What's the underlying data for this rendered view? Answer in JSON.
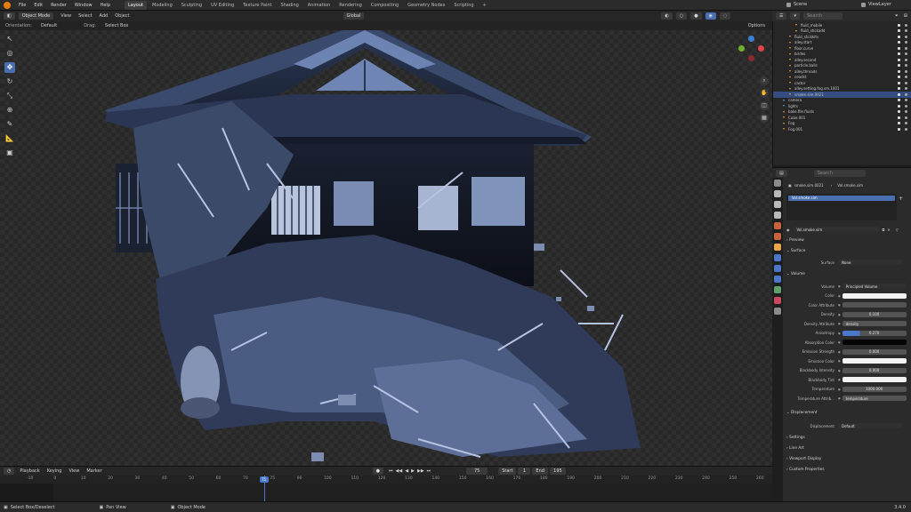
{
  "menu": {
    "items": [
      "File",
      "Edit",
      "Render",
      "Window",
      "Help"
    ]
  },
  "workspaces": [
    "Layout",
    "Modeling",
    "Sculpting",
    "UV Editing",
    "Texture Paint",
    "Shading",
    "Animation",
    "Rendering",
    "Compositing",
    "Geometry Nodes",
    "Scripting"
  ],
  "active_workspace": "Layout",
  "scene": {
    "scene_name": "Scene",
    "view_layer": "ViewLayer"
  },
  "viewport_header": {
    "mode": "Object Mode",
    "menus": [
      "View",
      "Select",
      "Add",
      "Object"
    ],
    "transform": "Global",
    "orientation_label": "Orientation:",
    "orientation_value": "Default",
    "drag_label": "Drag:",
    "drag_value": "Select Box",
    "options": "Options"
  },
  "outliner": {
    "search_placeholder": "Search",
    "rows": [
      {
        "name": "fluid_mobile",
        "indent": 3,
        "color": "#e8a54b",
        "selected": false
      },
      {
        "name": "fluid_stickadd",
        "indent": 3,
        "color": "#e8a54b",
        "selected": false
      },
      {
        "name": "fluid_stickkits",
        "indent": 2,
        "color": "#e8a54b",
        "selected": false
      },
      {
        "name": "alley.start",
        "indent": 2,
        "color": "#e8a54b",
        "selected": false
      },
      {
        "name": "floor.curve",
        "indent": 2,
        "color": "#e8a54b",
        "selected": false
      },
      {
        "name": "brides",
        "indent": 2,
        "color": "#e8a54b",
        "selected": false
      },
      {
        "name": "alley.second",
        "indent": 2,
        "color": "#e8a54b",
        "selected": false
      },
      {
        "name": "particle.balls",
        "indent": 2,
        "color": "#e8a54b",
        "selected": false
      },
      {
        "name": "alley.threads",
        "indent": 2,
        "color": "#e8a54b",
        "selected": false
      },
      {
        "name": "ceadst",
        "indent": 2,
        "color": "#e8a54b",
        "selected": false
      },
      {
        "name": "castor",
        "indent": 2,
        "color": "#e8a54b",
        "selected": false
      },
      {
        "name": "alley.setting.fog.sm.1001",
        "indent": 2,
        "color": "#e8a54b",
        "selected": false
      },
      {
        "name": "smoke.sim.0021",
        "indent": 2,
        "color": "#e8a54b",
        "selected": true
      },
      {
        "name": "camera",
        "indent": 1,
        "color": "#6ca0dc",
        "selected": false
      },
      {
        "name": "lights",
        "indent": 1,
        "color": "#6ca0dc",
        "selected": false
      },
      {
        "name": "bake.file.fluids",
        "indent": 1,
        "color": "#e8a54b",
        "selected": false
      },
      {
        "name": "Cube.001",
        "indent": 1,
        "color": "#e8a54b",
        "selected": false
      },
      {
        "name": "Fog",
        "indent": 1,
        "color": "#e8a54b",
        "selected": false
      },
      {
        "name": "Fog.001",
        "indent": 1,
        "color": "#e8a54b",
        "selected": false
      }
    ]
  },
  "properties": {
    "search_placeholder": "Search",
    "breadcrumb_object": "smoke.sim.0021",
    "breadcrumb_material": "Vol.smoke.sim",
    "material_slot": "Vol.smoke.sim",
    "material_name": "Vol.smoke.sim",
    "sections": {
      "preview": "Preview",
      "surface": "Surface",
      "volume": "Volume",
      "displacement": "Displacement",
      "settings": "Settings",
      "line_art": "Line Art",
      "viewport_display": "Viewport Display",
      "custom_properties": "Custom Properties"
    },
    "surface_row": {
      "label": "Surface",
      "value": "None"
    },
    "volume_rows": [
      {
        "label": "Volume",
        "value": "Principled Volume",
        "kind": "link"
      },
      {
        "label": "Color",
        "value": "",
        "kind": "color",
        "color": "#f2f2f2"
      },
      {
        "label": "Color Attribute",
        "value": "",
        "kind": "field"
      },
      {
        "label": "Density",
        "value": "0.100",
        "kind": "number"
      },
      {
        "label": "Density Attribute",
        "value": "density",
        "kind": "field"
      },
      {
        "label": "Anisotropy",
        "value": "0.270",
        "kind": "slider",
        "fraction": 0.27
      },
      {
        "label": "Absorption Color",
        "value": "",
        "kind": "color",
        "color": "#050505"
      },
      {
        "label": "Emission Strength",
        "value": "0.000",
        "kind": "number"
      },
      {
        "label": "Emission Color",
        "value": "",
        "kind": "color",
        "color": "#f2f2f2"
      },
      {
        "label": "Blackbody Intensity",
        "value": "0.000",
        "kind": "number"
      },
      {
        "label": "Blackbody Tint",
        "value": "",
        "kind": "color",
        "color": "#f2f2f2"
      },
      {
        "label": "Temperature",
        "value": "1000.000",
        "kind": "number"
      },
      {
        "label": "Temperature Attrib...",
        "value": "temperature",
        "kind": "field"
      }
    ],
    "displacement_row": {
      "label": "Displacement",
      "value": "Default"
    }
  },
  "timeline": {
    "menus": [
      "Playback",
      "Keying",
      "View",
      "Marker"
    ],
    "current_frame": "75",
    "start_label": "Start",
    "start": "1",
    "end_label": "End",
    "end": "195",
    "ticks": [
      "-10",
      "0",
      "10",
      "20",
      "30",
      "40",
      "50",
      "60",
      "70",
      "75",
      "90",
      "100",
      "110",
      "120",
      "130",
      "140",
      "150",
      "160",
      "170",
      "180",
      "190",
      "200",
      "210",
      "220",
      "230",
      "240",
      "250",
      "260"
    ],
    "current_fraction": 0.325
  },
  "status_bar": {
    "left": "Select Box/Deselect",
    "mid": "Pan View",
    "right": "Object Mode",
    "version": "3.4.0"
  },
  "colors": {
    "accent": "#4a6fb0",
    "selection": "#334d80",
    "orange": "#e87d0d",
    "axis_x": "#e0434c",
    "axis_y": "#6fb02f",
    "axis_z": "#3a7fd5"
  }
}
